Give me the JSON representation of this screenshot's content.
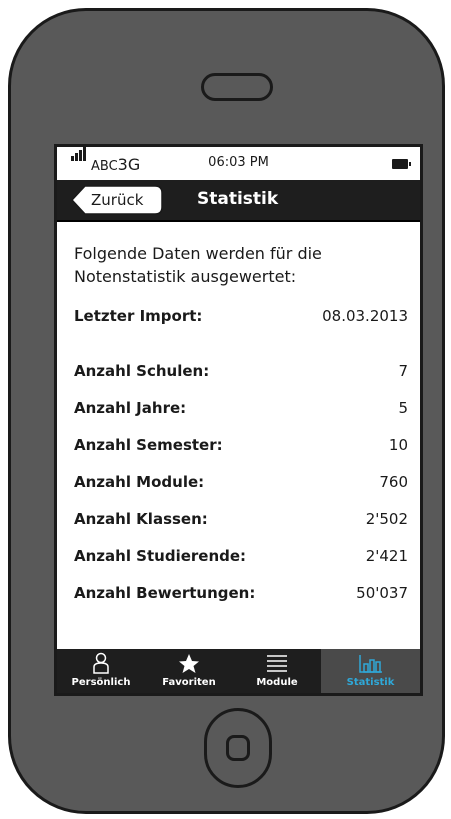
{
  "status_bar": {
    "carrier": "ABC",
    "network": "3G",
    "time": "06:03 PM"
  },
  "nav": {
    "back_label": "Zurück",
    "title": "Statistik"
  },
  "content": {
    "intro": "Folgende Daten werden für die Notenstatistik ausgewertet:",
    "last_import": {
      "label": "Letzter Import:",
      "value": "08.03.2013"
    },
    "stats": [
      {
        "label": "Anzahl Schulen:",
        "value": "7"
      },
      {
        "label": "Anzahl Jahre:",
        "value": "5"
      },
      {
        "label": "Anzahl Semester:",
        "value": "10"
      },
      {
        "label": "Anzahl Module:",
        "value": "760"
      },
      {
        "label": "Anzahl Klassen:",
        "value": "2'502"
      },
      {
        "label": "Anzahl Studierende:",
        "value": "2'421"
      },
      {
        "label": "Anzahl Bewertungen:",
        "value": "50'037"
      }
    ]
  },
  "tabs": [
    {
      "label": "Persönlich",
      "icon": "person-icon",
      "active": false
    },
    {
      "label": "Favoriten",
      "icon": "star-icon",
      "active": false
    },
    {
      "label": "Module",
      "icon": "list-icon",
      "active": false
    },
    {
      "label": "Statistik",
      "icon": "bar-chart-icon",
      "active": true
    }
  ],
  "colors": {
    "frame": "#595959",
    "bar": "#1e1e1e",
    "active_tab": "#4a4a4a",
    "accent": "#2fa8d8"
  }
}
